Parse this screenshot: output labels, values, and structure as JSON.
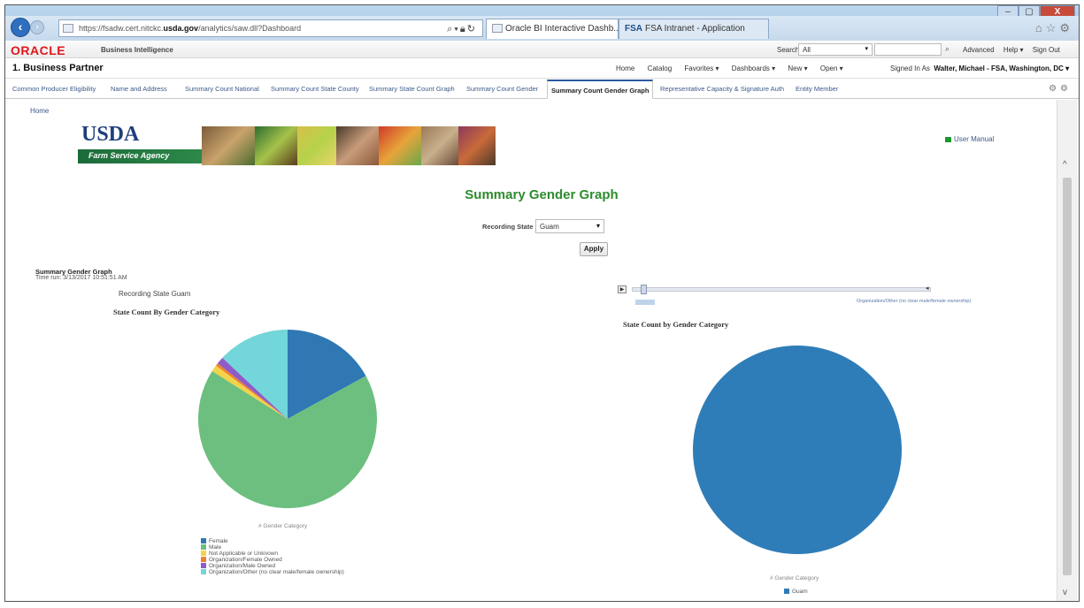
{
  "browser": {
    "url_prefix": "https://fsadw.cert.nitckc.",
    "url_domain": "usda.gov",
    "url_path": "/analytics/saw.dll?Dashboard",
    "tabs": [
      {
        "label": "Oracle BI Interactive Dashb...",
        "close": "×"
      },
      {
        "label": "FSA Intranet - Application",
        "icon": "FSA"
      }
    ],
    "min_label": "–",
    "max_label": "▢",
    "close_label": "X"
  },
  "obi": {
    "logo": "ORACLE",
    "product": "Business Intelligence",
    "search_label": "Search",
    "search_scope": "All",
    "links": [
      "Advanced",
      "Help ▾",
      "Sign Out"
    ]
  },
  "dashboard": {
    "title": "1. Business Partner",
    "menu": [
      "Home",
      "Catalog",
      "Favorites ▾",
      "Dashboards ▾",
      "New ▾",
      "Open ▾"
    ],
    "signed_in_label": "Signed In As",
    "signed_in_user": "Walter, Michael - FSA, Washington, DC ▾"
  },
  "page_tabs": [
    "Common Producer Eligibility",
    "Name and Address",
    "Summary Count National",
    "Summary Count State County",
    "Summary State Count Graph",
    "Summary Count Gender",
    "Summary Count Gender Graph",
    "Representative Capacity & Signature Auth",
    "Entity Member"
  ],
  "active_tab": "Summary Count Gender Graph",
  "content": {
    "home_link": "Home",
    "usda_word": "USDA",
    "agency": "Farm Service Agency",
    "user_manual": "User Manual",
    "page_title": "Summary Gender Graph",
    "recording_state_label": "Recording State",
    "recording_state_value": "Guam",
    "apply_label": "Apply",
    "report_title": "Summary Gender Graph",
    "time_run": "Time run: 3/13/2017 10:51:51 AM",
    "recording_state_text": "Recording State Guam",
    "slider_max_label": "Organization/Other (no clear male/female ownership)"
  },
  "colors": {
    "female": "#2f78b4",
    "male": "#6cbf7f",
    "not_applicable": "#f2d349",
    "org_female": "#f08030",
    "org_male": "#8e5cc8",
    "org_other": "#72d6da",
    "guam": "#2f7db8"
  },
  "chart_data": [
    {
      "type": "pie",
      "title": "State Count By Gender Category",
      "legend_caption": "# Gender Category",
      "labels": [
        "Female",
        "Male",
        "Not Applicable or Unknown",
        "Organization/Female Owned",
        "Organization/Male Owned",
        "Organization/Other (no clear male/female ownership)"
      ],
      "values": [
        17,
        67,
        1.2,
        0.5,
        1.3,
        13
      ],
      "legend": "bottom-left"
    },
    {
      "type": "pie",
      "title": "State Count by Gender Category",
      "legend_caption": "# Gender Category",
      "labels": [
        "Guam"
      ],
      "values": [
        100
      ],
      "legend": "bottom"
    }
  ]
}
